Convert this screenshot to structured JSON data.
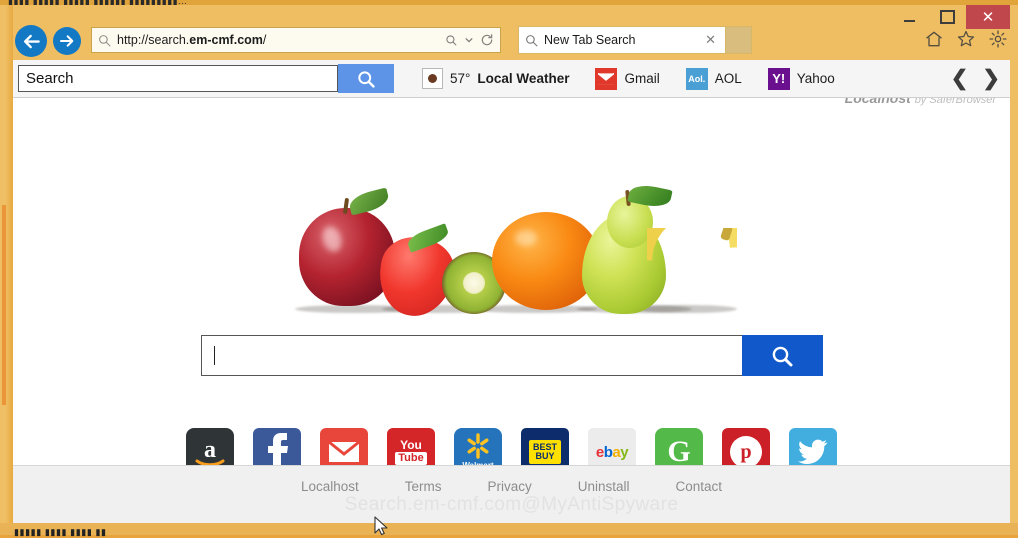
{
  "window": {
    "title_bar_noise": "▮▮▮▮ ▮▮▮▮▮ ▮▮▮▮▮     ▮▮▮▮▮▮ ▮▮▮▮▮▮▮▮▮...",
    "bottom_noise": "▮▮▮▮▮ ▮▮▮▮ ▮▮▮▮ ▮▮",
    "minimize_label": "",
    "maximize_label": "",
    "close_label": "✕",
    "controls": {
      "minimize_name": "minimize-button",
      "maximize_name": "maximize-button",
      "close_name": "close-button"
    }
  },
  "nav": {
    "back_label": "Back",
    "forward_label": "Forward",
    "url_prefix": "http://search.",
    "url_domain": "em-cmf.com",
    "url_suffix": "/",
    "url_full": "http://search.em-cmf.com/",
    "search_icon": "search-icon",
    "zoom_icon": "search-dropdown-icon",
    "refresh_icon": "refresh-icon"
  },
  "tabs": {
    "active_label": "New Tab Search",
    "close_label": "✕",
    "new_tab_label": ""
  },
  "browser_icons": [
    {
      "name": "home-icon"
    },
    {
      "name": "favorites-star-icon"
    },
    {
      "name": "settings-gear-icon"
    }
  ],
  "toolbar": {
    "search_value": "Search",
    "search_placeholder": "Search",
    "search_button_icon": "search-icon",
    "weather": {
      "temperature": "57°",
      "label": "Local Weather",
      "icon": "weather-icon"
    },
    "links": [
      {
        "name": "gmail",
        "label": "Gmail",
        "badge": "M",
        "color": "#e0392b"
      },
      {
        "name": "aol",
        "label": "AOL",
        "badge": "Aol.",
        "color": "#4a9fd4"
      },
      {
        "name": "yahoo",
        "label": "Yahoo",
        "badge": "Y!",
        "color": "#6a0f8e"
      }
    ],
    "prev_arrow": "❮",
    "next_arrow": "❯"
  },
  "page": {
    "brand": "Localhost",
    "brand_by": "by SaferBrowser",
    "fruit_alt": "fruit-collage-image",
    "search_value": "",
    "search_placeholder": "",
    "search_button_icon": "search-icon",
    "tiles": [
      {
        "name": "amazon",
        "label": "amazon",
        "bg": "#2f3437",
        "fg": "#ffffff"
      },
      {
        "name": "facebook",
        "label": "facebook",
        "bg": "#3b5998",
        "fg": "#ffffff"
      },
      {
        "name": "gmail",
        "label": "gmail",
        "bg": "#e8463a",
        "fg": "#ffffff"
      },
      {
        "name": "youtube",
        "label": "youtube",
        "bg": "#d42628",
        "fg": "#ffffff"
      },
      {
        "name": "walmart",
        "label": "walmart",
        "bg": "#2574bb",
        "fg": "#ffc220"
      },
      {
        "name": "bestbuy",
        "label": "bestbuy",
        "bg": "#0c2c6b",
        "fg": "#ffe000"
      },
      {
        "name": "ebay",
        "label": "ebay",
        "bg": "#ececec",
        "fg": "#e53238"
      },
      {
        "name": "groupon",
        "label": "groupon",
        "bg": "#53b948",
        "fg": "#ffffff"
      },
      {
        "name": "pinterest",
        "label": "pinterest",
        "bg": "#cb2027",
        "fg": "#ffffff"
      },
      {
        "name": "twitter",
        "label": "twitter",
        "bg": "#42aee0",
        "fg": "#ffffff"
      }
    ],
    "footer_links": [
      "Localhost",
      "Terms",
      "Privacy",
      "Uninstall",
      "Contact"
    ],
    "watermark": "Search.em-cmf.com@MyAntiSpyware"
  },
  "colors": {
    "frame": "#efbe63",
    "accent_blue": "#1159cb",
    "toolbar_blue": "#5e94e8",
    "nav_blue": "#1379c4",
    "close_red": "#c0474b"
  }
}
